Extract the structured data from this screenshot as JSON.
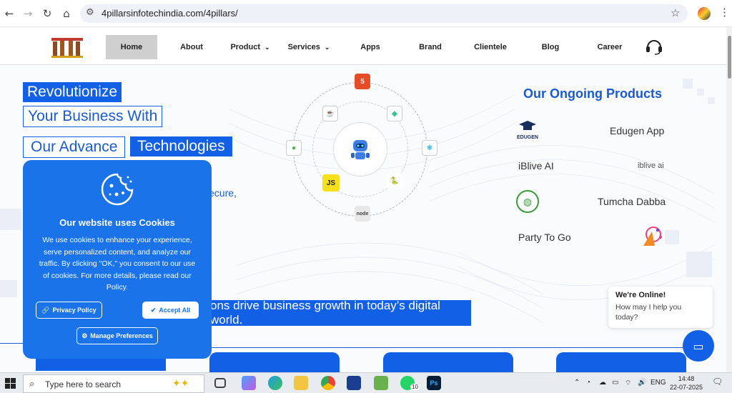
{
  "browser": {
    "url": "4pillarsinfotechindia.com/4pillars/"
  },
  "nav": {
    "items": [
      {
        "label": "Home",
        "active": true
      },
      {
        "label": "About"
      },
      {
        "label": "Product",
        "dropdown": true
      },
      {
        "label": "Services",
        "dropdown": true
      },
      {
        "label": "Apps"
      },
      {
        "label": "Brand"
      },
      {
        "label": "Clientele"
      },
      {
        "label": "Blog"
      },
      {
        "label": "Career"
      }
    ]
  },
  "hero": {
    "line1": "Revolutionize",
    "line2": "Your Business With",
    "line3a": "Our Advance",
    "line3b": "Technologies",
    "partial": "ecure,",
    "banner": "ons drive business growth in today’s digital world."
  },
  "tech_icons": {
    "html": "5",
    "js": "JS",
    "node": "node"
  },
  "products": {
    "title": "Our Ongoing Products",
    "edugen_logo": "EDUGEN",
    "edugen": "Edugen App",
    "iblive": "iBlive AI",
    "iblive_logo": "iblive ai",
    "tumcha": "Tumcha Dabba",
    "partytogo": "Party To Go"
  },
  "cookie": {
    "title": "Our website uses Cookies",
    "text": "We use cookies to enhance your experience, serve personalized content, and analyze our traffic. By clicking \"OK,\" you consent to our use of cookies. For more details, please read our Policy.",
    "privacy": "Privacy Policy",
    "accept": "Accept All",
    "manage": "Manage Preferences"
  },
  "chat": {
    "title": "We're Online!",
    "text": "How may I help you today?"
  },
  "taskbar": {
    "search_placeholder": "Type here to search",
    "time": "14:48",
    "date": "22-07-2025",
    "lang": "ENG",
    "badge": "10"
  },
  "colors": {
    "brand_blue": "#1260e6"
  }
}
